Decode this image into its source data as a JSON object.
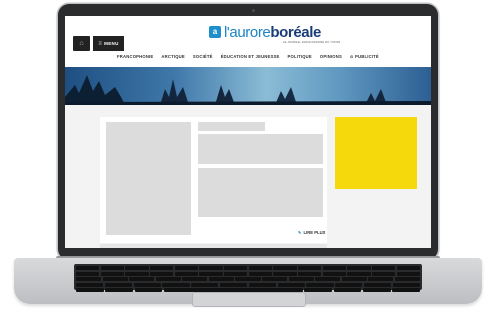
{
  "header": {
    "home_icon": "⌂",
    "menu_label": "MENU",
    "logo_plain": "l'aurore",
    "logo_bold": "boréale",
    "tagline": "LE JOURNAL FRANCOPHONE DU YUKON"
  },
  "nav": {
    "items": [
      "FRANCOPHONIE",
      "ARCTIQUE",
      "SOCIÉTÉ",
      "ÉDUCATION ET JEUNESSE",
      "POLITIQUE",
      "OPINIONS",
      "⊙ PUBLICITÉ"
    ]
  },
  "article": {
    "read_more": "LIRE PLUS",
    "read_more_icon": "✎"
  },
  "colors": {
    "brand_blue": "#1b84c2",
    "ad_yellow": "#f6d90c"
  }
}
